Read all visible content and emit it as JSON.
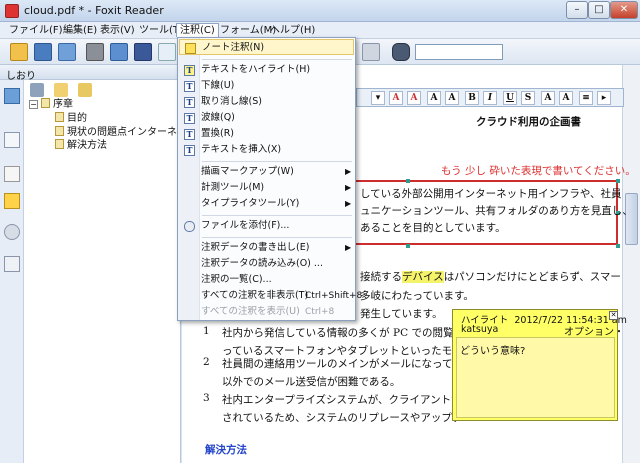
{
  "window": {
    "title": "cloud.pdf * - Foxit Reader",
    "min": "–",
    "max": "□",
    "close": "✕"
  },
  "menubar": [
    "ファイル(F)",
    "編集(E)",
    "表示(V)",
    "ツール(T)",
    "注釈(C)",
    "フォーム(M)",
    "ヘルプ(H)"
  ],
  "left_panel": {
    "tab_label": "しおり",
    "bookmarks": [
      "序章",
      "目的",
      "現状の問題点インターネット",
      "解決方法"
    ]
  },
  "dropdown": {
    "items": [
      {
        "label": "ノート注釈(N)",
        "icon": "note-icon"
      },
      {
        "label": "テキストをハイライト(H)",
        "icon": "highlight-icon"
      },
      {
        "label": "下線(U)",
        "icon": "underline-icon"
      },
      {
        "label": "取り消し線(S)",
        "icon": "strikeout-icon"
      },
      {
        "label": "波線(Q)",
        "icon": "squiggly-icon"
      },
      {
        "label": "置換(R)",
        "icon": "replace-icon"
      },
      {
        "label": "テキストを挿入(X)",
        "icon": "insert-text-icon"
      },
      {
        "label": "描画マークアップ(W)",
        "arrow": "▶"
      },
      {
        "label": "計測ツール(M)",
        "arrow": "▶"
      },
      {
        "label": "タイプライタツール(Y)",
        "arrow": "▶"
      },
      {
        "label": "ファイルを添付(F)...",
        "icon": "attach-icon"
      },
      {
        "label": "注釈データの書き出し(E)",
        "arrow": "▶"
      },
      {
        "label": "注釈データの読み込み(O) ..."
      },
      {
        "label": "注釈の一覧(C)..."
      },
      {
        "label": "すべての注釈を非表示(T)",
        "shortcut": "Ctrl+Shift+8"
      },
      {
        "label": "すべての注釈を表示(U)",
        "shortcut": "Ctrl+8",
        "disabled": true
      }
    ]
  },
  "document": {
    "title": "クラウド利用の企画書",
    "red_note": "もう 少し 砕いた表現で書いてください。",
    "box_lines": [
      "している外部公開用インターネット用インフラや、社員",
      "ュニケーションツール、共有フォルダのあり方を見直し、",
      "あることを目的としています。"
    ],
    "para_line1_pre": "接続する",
    "para_line1_hl": "デバイス",
    "para_line1_post": "はパソコンだけにとどまらず、スマー",
    "para_line2": "多岐にわたっています。",
    "para_line3": "発生しています。",
    "list": [
      {
        "num": "1",
        "line1": "社内から発信している情報の多くが PC での閲覧を",
        "line2": "っているスマートフォンやタブレットといったモバ"
      },
      {
        "num": "2",
        "line1": "社員間の連絡用ツールのメインがメールになってい",
        "line2": "以外でのメール送受信が困難である。"
      },
      {
        "num": "3",
        "line1": "社内エンタープライズシステムが、クライアントサ",
        "line2": "されているため、システムのリプレースやアップデ"
      }
    ],
    "next_section": "解決方法"
  },
  "popup": {
    "type": "ハイライト",
    "date": "2012/7/22 11:54:31 am",
    "close": "✕",
    "author": "katsuya",
    "body": "どういう意味?",
    "side_text": "オプション・"
  },
  "search": {
    "value": ""
  },
  "colors": {
    "accent": "#cc2d2d",
    "highlight": "#f5f36a",
    "note_bg": "#ffff66"
  }
}
